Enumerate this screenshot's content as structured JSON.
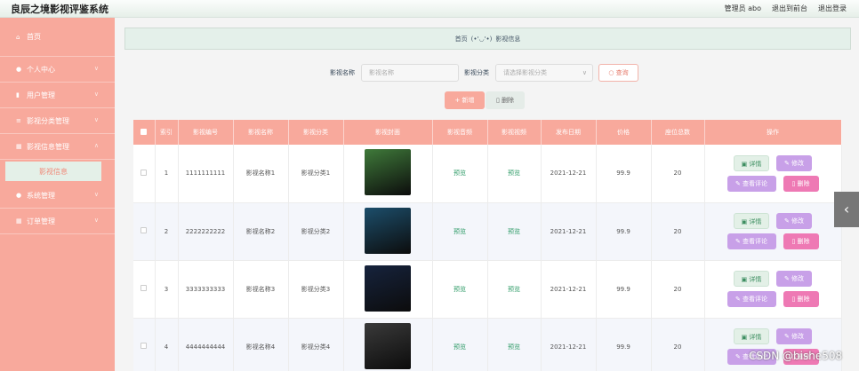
{
  "header": {
    "app_title": "良辰之境影视评鉴系统",
    "admin_label": "管理员 abo",
    "back_to_front": "退出到前台",
    "logout": "退出登录"
  },
  "sidebar": {
    "items": [
      {
        "label": "首页",
        "icon": "home-icon"
      },
      {
        "label": "个人中心",
        "icon": "user-icon"
      },
      {
        "label": "用户管理",
        "icon": "bar-chart-icon"
      },
      {
        "label": "影视分类管理",
        "icon": "list-icon"
      },
      {
        "label": "影视信息管理",
        "icon": "grid-icon"
      },
      {
        "label": "系统管理",
        "icon": "dot-icon"
      },
      {
        "label": "订单管理",
        "icon": "table-icon"
      }
    ],
    "active_sub": "影视信息"
  },
  "breadcrumb": {
    "home": "首页",
    "sep": "(•'◡'•)",
    "current": "影视信息"
  },
  "search": {
    "name_label": "影视名称",
    "name_placeholder": "影视名称",
    "category_label": "影视分类",
    "category_placeholder": "请选择影视分类",
    "query_button": "查询"
  },
  "actions": {
    "add": "+ 新增",
    "delete": "删除"
  },
  "table": {
    "headers": [
      "索引",
      "影视编号",
      "影视名称",
      "影视分类",
      "影视封面",
      "影视音频",
      "影视视频",
      "发布日期",
      "价格",
      "座位总数",
      "操作"
    ],
    "rows": [
      {
        "index": "1",
        "code": "1111111111",
        "name": "影视名称1",
        "category": "影视分类1",
        "audio": "预览",
        "video": "预览",
        "date": "2021-12-21",
        "price": "99.9",
        "seats": "20",
        "poster_color": "#3f7a3a"
      },
      {
        "index": "2",
        "code": "2222222222",
        "name": "影视名称2",
        "category": "影视分类2",
        "audio": "预览",
        "video": "预览",
        "date": "2021-12-21",
        "price": "99.9",
        "seats": "20",
        "poster_color": "#1c4e6b"
      },
      {
        "index": "3",
        "code": "3333333333",
        "name": "影视名称3",
        "category": "影视分类3",
        "audio": "预览",
        "video": "预览",
        "date": "2021-12-21",
        "price": "99.9",
        "seats": "20",
        "poster_color": "#16233d"
      },
      {
        "index": "4",
        "code": "4444444444",
        "name": "影视名称4",
        "category": "影视分类4",
        "audio": "预览",
        "video": "预览",
        "date": "2021-12-21",
        "price": "99.9",
        "seats": "20",
        "poster_color": "#3a3a3a"
      }
    ],
    "op_labels": {
      "detail": "详情",
      "edit": "修改",
      "review": "查看评论",
      "delete": "删除"
    }
  },
  "watermark": "CSDN @bishe508"
}
